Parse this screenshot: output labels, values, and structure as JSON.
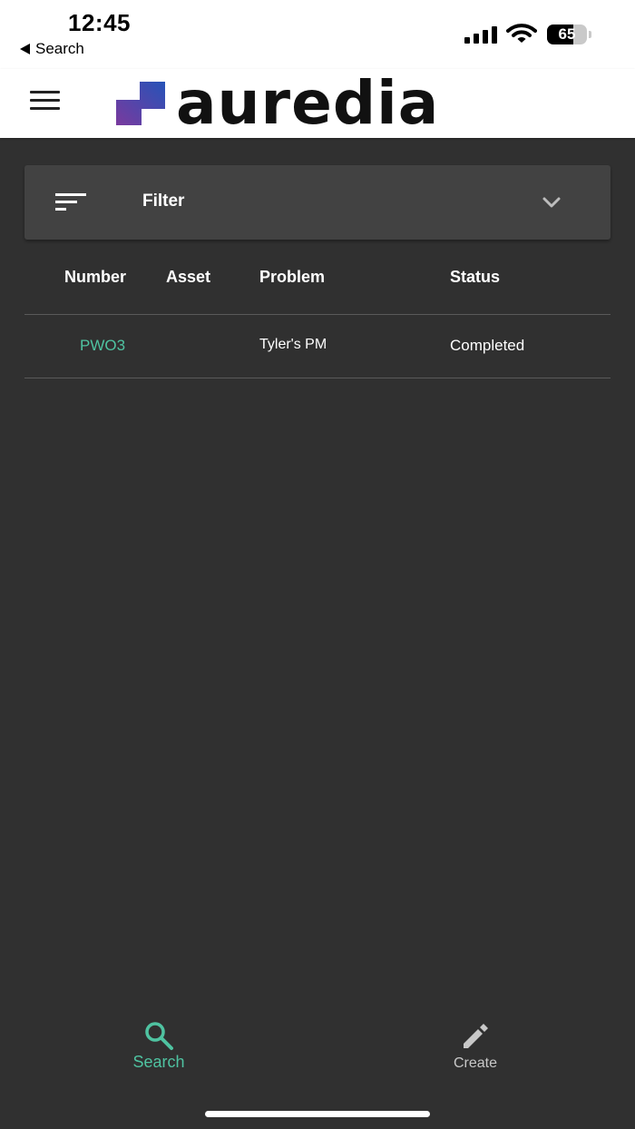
{
  "status_bar": {
    "time": "12:45",
    "back_app_label": "Search",
    "battery_level": "65",
    "battery_fraction": 0.65
  },
  "header": {
    "menu_icon": "hamburger-menu-icon",
    "logo_text": "auredia",
    "logo_colors": [
      "#2b4fb3",
      "#6b3fa0"
    ]
  },
  "filter": {
    "label": "Filter",
    "icon": "filter-list-icon",
    "expand_icon": "chevron-down-icon"
  },
  "table": {
    "columns": [
      "Number",
      "Asset",
      "Problem",
      "Status"
    ],
    "rows": [
      {
        "number": "PWO3",
        "asset": "",
        "problem": "Tyler's PM",
        "status": "Completed"
      }
    ]
  },
  "bottom_nav": {
    "items": [
      {
        "label": "Search",
        "icon": "search-icon",
        "active": true
      },
      {
        "label": "Create",
        "icon": "pencil-icon",
        "active": false
      }
    ]
  },
  "colors": {
    "background": "#303030",
    "surface": "#424242",
    "accent": "#4fc3a1",
    "inactive": "#c8c8c8"
  }
}
